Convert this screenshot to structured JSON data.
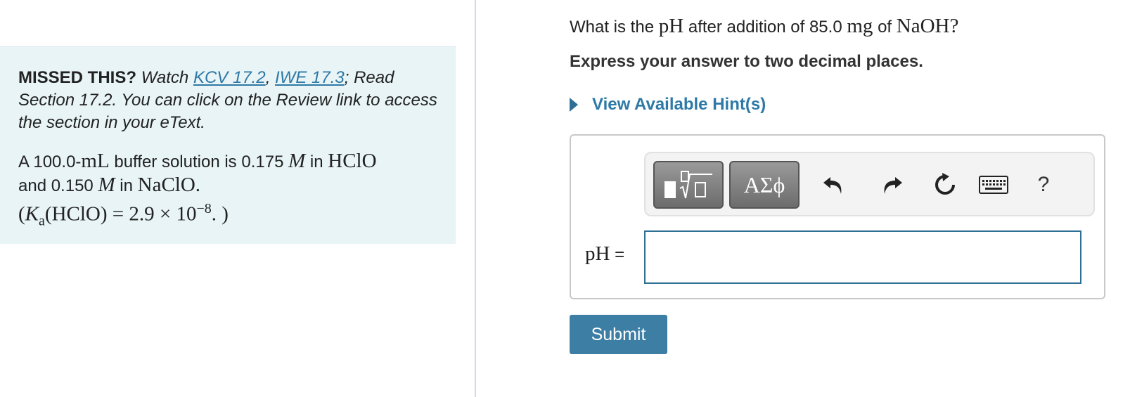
{
  "left_panel": {
    "missed_title": "MISSED THIS?",
    "missed_watch": "Watch",
    "link_kcv": "KCV 17.2",
    "link_separator": ",",
    "link_iwe": "IWE 17.3",
    "missed_rest": "; Read Section 17.2. You can click on the Review link to access the section in your eText.",
    "problem": {
      "p1_a": "A 100.0-",
      "volume_unit": "mL",
      "p1_b": " buffer solution is 0.175 ",
      "molarity_symbol": "M",
      "p1_c": " in ",
      "acid": "HClO",
      "p2_a": "and 0.150 ",
      "p2_b": " in ",
      "salt": "NaClO",
      "p2_end": ".",
      "ka_open": "(",
      "ka_symbol": "K",
      "ka_subscript": "a",
      "ka_mid": "(HClO) = 2.9 × 10",
      "ka_exponent": "−8",
      "ka_close": ". )"
    }
  },
  "question": {
    "q_a": "What is the ",
    "q_ph": "pH",
    "q_b": " after addition of 85.0 ",
    "q_mg": "mg",
    "q_c": " of ",
    "q_naoh": "NaOH",
    "q_end": "?"
  },
  "instruction": "Express your answer to two decimal places.",
  "hints": {
    "label": "View Available Hint(s)"
  },
  "toolbar": {
    "greek_label": "ΑΣϕ",
    "help_label": "?",
    "icons": [
      "templates-icon",
      "undo-icon",
      "redo-icon",
      "reset-icon",
      "keyboard-icon"
    ]
  },
  "answer": {
    "label_var": "pH",
    "label_eq": " =",
    "value": ""
  },
  "submit_label": "Submit",
  "colors": {
    "accent": "#2e79a6",
    "submit_bg": "#3d7ea5",
    "panel_bg": "#e8f4f6",
    "input_border": "#2e6f95"
  }
}
